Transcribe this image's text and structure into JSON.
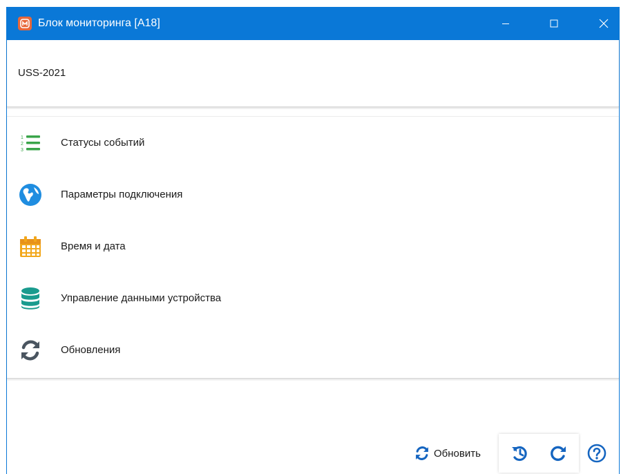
{
  "window": {
    "title": "Блок мониторинга [A18]",
    "controls": {
      "minimize": "minimize-icon",
      "maximize": "maximize-icon",
      "close": "close-icon"
    }
  },
  "device": {
    "name": "USS-2021"
  },
  "menu": {
    "items": [
      {
        "label": "Статусы событий",
        "icon": "numbered-list-icon",
        "color": "#3aa54a"
      },
      {
        "label": "Параметры подключения",
        "icon": "globe-icon",
        "color": "#1f8de0"
      },
      {
        "label": "Время и дата",
        "icon": "calendar-icon",
        "color": "#f2a71b"
      },
      {
        "label": "Управление данными устройства",
        "icon": "database-icon",
        "color": "#1a9b8e"
      },
      {
        "label": "Обновления",
        "icon": "sync-icon",
        "color": "#4a5560"
      }
    ]
  },
  "toolbar": {
    "refresh_label": "Обновить",
    "history_icon": "history-icon",
    "reload_icon": "reload-icon",
    "help_icon": "help-icon"
  },
  "colors": {
    "accent": "#0a78d7",
    "icon_blue": "#1565c0"
  }
}
